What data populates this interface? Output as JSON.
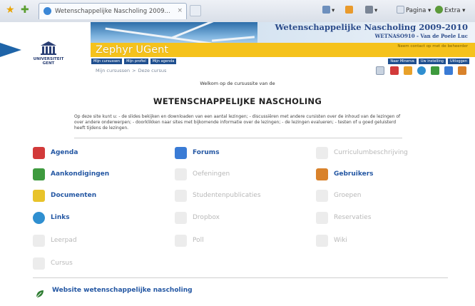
{
  "browser": {
    "tab_title": "Wetenschappelijke Nascholing 2009...",
    "tab_close": "×",
    "tools": [
      {
        "label": "▾",
        "icon": "home-icon"
      },
      {
        "label": "▾",
        "icon": "feeds-icon"
      },
      {
        "label": "▾",
        "icon": "print-icon"
      },
      {
        "label": "Pagina ▾",
        "icon": "page-icon"
      },
      {
        "label": "Extra ▾",
        "icon": "tools-icon"
      }
    ]
  },
  "header": {
    "site_title": "Wetenschappelijke Nascholing 2009-2010",
    "site_subtitle": "WETNASO910 - Van de Poele Luc",
    "product_name": "Zephyr UGent",
    "yellow_note": "Neem contact op met de beheerder",
    "university_name": "UNIVERSITEIT GENT",
    "nav_left": [
      "Mijn cursussen",
      "Mijn profiel",
      "Mijn agenda"
    ],
    "nav_right": [
      "Naar Minerva",
      "Uw instelling",
      "Uitloggen"
    ],
    "breadcrumb": [
      "Mijn cursussen",
      "Deze cursus"
    ],
    "breadcrumb_sep": ">"
  },
  "intro": {
    "welcome": "Welkom op de cursussite van de",
    "course_title": "WETENSCHAPPELIJKE NASCHOLING",
    "description": "Op deze site kunt u: - de slides bekijken en downloaden van een aantal lezingen; - discussiëren met andere cursisten over de inhoud van de lezingen of over andere onderwerpen; - doorklikken naar sites met bijkomende informatie over de lezingen; - de lezingen evalueren; - testen of u goed geluisterd heeft tijdens de lezingen."
  },
  "tools": [
    {
      "label": "Agenda",
      "icon": "calendar-icon",
      "active": true,
      "color": "#d23a3a"
    },
    {
      "label": "Forums",
      "icon": "forum-icon",
      "active": true,
      "color": "#3a7bd5"
    },
    {
      "label": "Curriculumbeschrijving",
      "icon": "curriculum-icon",
      "active": false,
      "color": "#c9c9c9"
    },
    {
      "label": "Aankondigingen",
      "icon": "announcements-icon",
      "active": true,
      "color": "#3e9a3e"
    },
    {
      "label": "Oefeningen",
      "icon": "exercises-icon",
      "active": false,
      "color": "#c9c9c9"
    },
    {
      "label": "Gebruikers",
      "icon": "users-icon",
      "active": true,
      "color": "#d9822b"
    },
    {
      "label": "Documenten",
      "icon": "folder-icon",
      "active": true,
      "color": "#e8c32a"
    },
    {
      "label": "Studentenpublicaties",
      "icon": "publications-icon",
      "active": false,
      "color": "#c9c9c9"
    },
    {
      "label": "Groepen",
      "icon": "groups-icon",
      "active": false,
      "color": "#c9c9c9"
    },
    {
      "label": "Links",
      "icon": "globe-icon",
      "active": true,
      "color": "#2f8fd0"
    },
    {
      "label": "Dropbox",
      "icon": "dropbox-icon",
      "active": false,
      "color": "#c9c9c9"
    },
    {
      "label": "Reservaties",
      "icon": "reservations-icon",
      "active": false,
      "color": "#c9c9c9"
    },
    {
      "label": "Leerpad",
      "icon": "learning-path-icon",
      "active": false,
      "color": "#c9c9c9"
    },
    {
      "label": "Poll",
      "icon": "poll-icon",
      "active": false,
      "color": "#c9c9c9"
    },
    {
      "label": "Wiki",
      "icon": "wiki-icon",
      "active": false,
      "color": "#c9c9c9"
    },
    {
      "label": "Cursus",
      "icon": "course-icon",
      "active": false,
      "color": "#c9c9c9"
    }
  ],
  "website_link": {
    "label": "Website wetenschappelijke nascholing",
    "icon": "leaf-link-icon",
    "color": "#2e7d32"
  },
  "colors": {
    "header_blue": "#2b4b8a",
    "accent_yellow": "#f5c21c",
    "link_blue": "#2457a3",
    "nav_blue": "#1f4f8f"
  }
}
